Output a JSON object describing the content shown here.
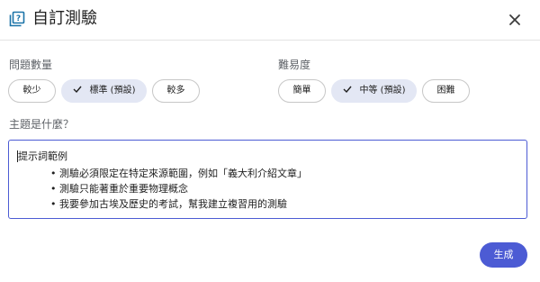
{
  "dialog": {
    "title": "自訂測驗",
    "icon": "quiz-icon",
    "close_icon": "close-icon"
  },
  "question_count": {
    "label": "問題數量",
    "options": [
      {
        "label": "較少",
        "selected": false
      },
      {
        "label": "標準 (預設)",
        "selected": true
      },
      {
        "label": "較多",
        "selected": false
      }
    ]
  },
  "difficulty": {
    "label": "難易度",
    "options": [
      {
        "label": "簡單",
        "selected": false
      },
      {
        "label": "中等 (預設)",
        "selected": true
      },
      {
        "label": "困難",
        "selected": false
      }
    ]
  },
  "topic": {
    "label": "主題是什麼？",
    "prompt_title": "提示詞範例",
    "examples": [
      "測驗必須限定在特定來源範圍，例如「義大利介紹文章」",
      "測驗只能著重於重要物理概念",
      "我要參加古埃及歷史的考試，幫我建立複習用的測驗"
    ]
  },
  "footer": {
    "generate_label": "生成"
  },
  "colors": {
    "accent": "#4c5bd4",
    "chip_selected_bg": "#e3e7f4",
    "border": "#c7c7c7",
    "label_text": "#5f6368"
  }
}
